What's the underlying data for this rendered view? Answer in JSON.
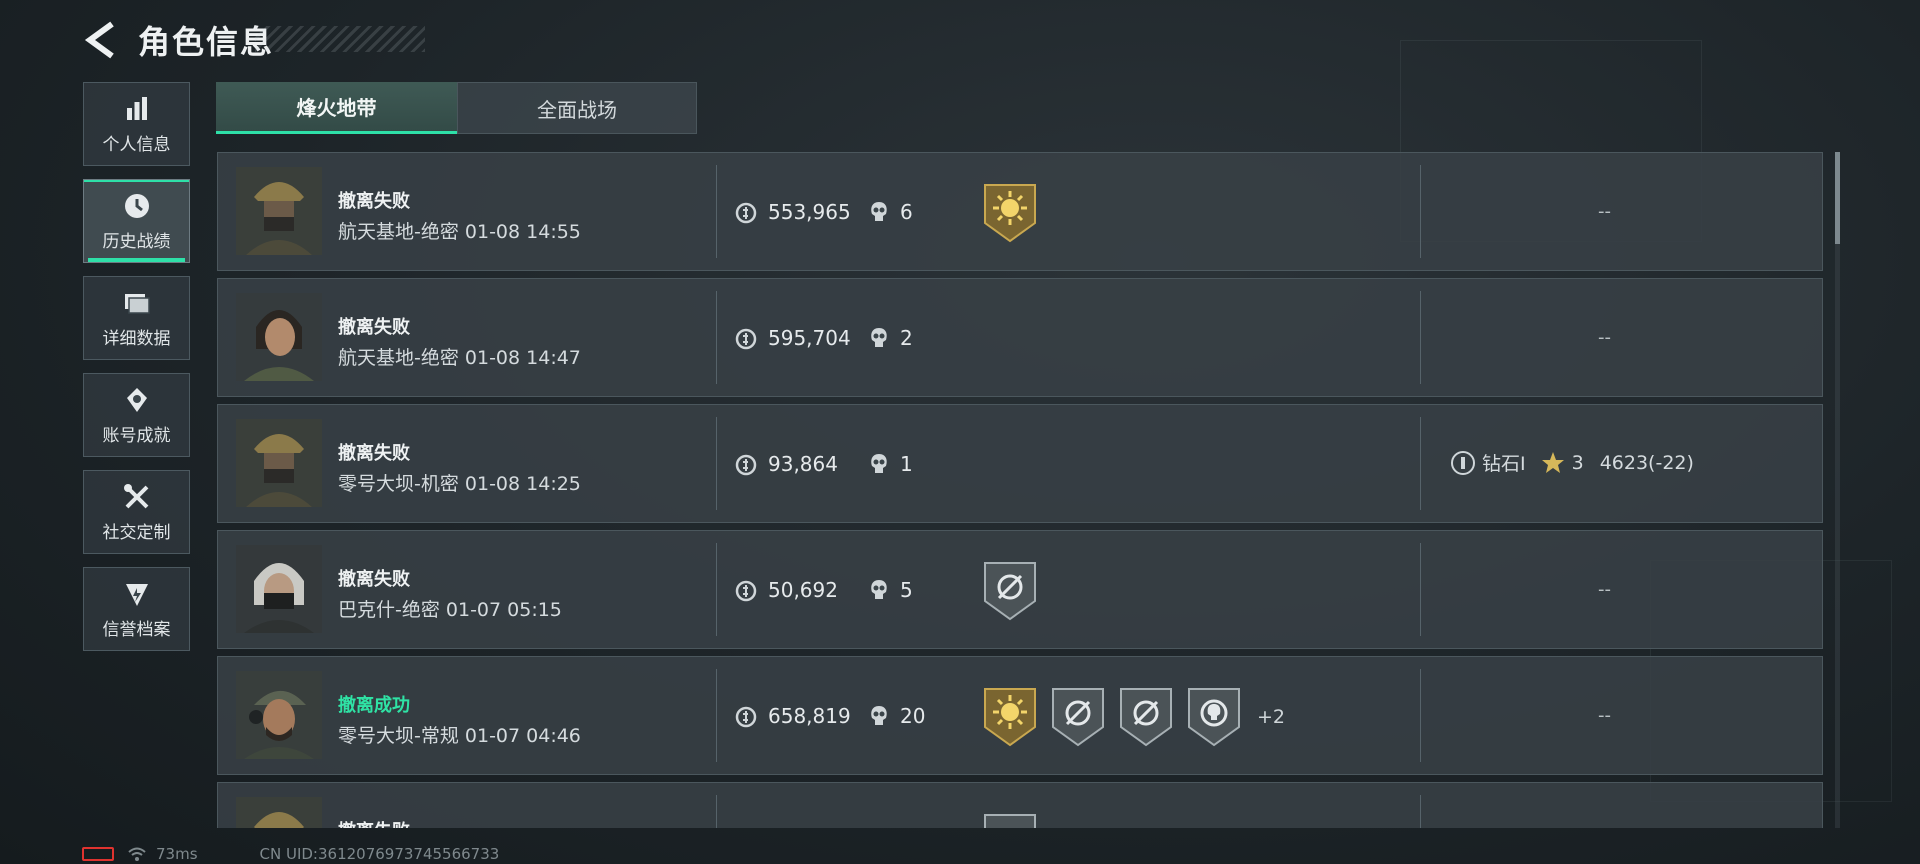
{
  "header": {
    "title": "角色信息"
  },
  "sidebar": {
    "items": [
      {
        "label": "个人信息",
        "icon": "stats-bars-icon",
        "active": false
      },
      {
        "label": "历史战绩",
        "icon": "history-clock-icon",
        "active": true
      },
      {
        "label": "详细数据",
        "icon": "folders-icon",
        "active": false
      },
      {
        "label": "账号成就",
        "icon": "achievement-icon",
        "active": false
      },
      {
        "label": "社交定制",
        "icon": "tools-icon",
        "active": false
      },
      {
        "label": "信誉档案",
        "icon": "credit-badge-icon",
        "active": false
      }
    ]
  },
  "tabs": [
    {
      "label": "烽火地带",
      "active": true
    },
    {
      "label": "全面战场",
      "active": false
    }
  ],
  "records": [
    {
      "result": "撤离失败",
      "success": false,
      "map": "航天基地-绝密 01-08 14:55",
      "value": "553,965",
      "kills": "6",
      "badges": [
        "gold-sun-badge"
      ],
      "extra": "",
      "rank": "--",
      "avatar": "helmet-operator"
    },
    {
      "result": "撤离失败",
      "success": false,
      "map": "航天基地-绝密 01-08 14:47",
      "value": "595,704",
      "kills": "2",
      "badges": [],
      "extra": "",
      "rank": "--",
      "avatar": "female-operator"
    },
    {
      "result": "撤离失败",
      "success": false,
      "map": "零号大坝-机密 01-08 14:25",
      "value": "93,864",
      "kills": "1",
      "badges": [],
      "extra": "",
      "rank": "",
      "rank_tier": "钻石I",
      "rank_stars": "3",
      "rank_score": "4623(-22)",
      "avatar": "helmet-operator"
    },
    {
      "result": "撤离失败",
      "success": false,
      "map": "巴克什-绝密 01-07 05:15",
      "value": "50,692",
      "kills": "5",
      "badges": [
        "silver-crosshair-badge"
      ],
      "extra": "",
      "rank": "--",
      "avatar": "masked-operator"
    },
    {
      "result": "撤离成功",
      "success": true,
      "map": "零号大坝-常规 01-07 04:46",
      "value": "658,819",
      "kills": "20",
      "badges": [
        "gold-sun-badge",
        "silver-crosshair-badge",
        "silver-crosshair-badge",
        "silver-skull-badge"
      ],
      "extra": "+2",
      "rank": "--",
      "avatar": "cap-operator"
    },
    {
      "result": "撤离失败",
      "success": false,
      "map": "",
      "value": "",
      "kills": "",
      "badges": [
        "silver-badge"
      ],
      "extra": "",
      "rank": "",
      "avatar": "helmet-operator"
    }
  ],
  "status_bar": {
    "ping": "73ms",
    "uid": "CN UID:3612076973745566733"
  },
  "colors": {
    "accent": "#2ee0a8",
    "success": "#2fe3a5",
    "battery": "#e0332f"
  }
}
